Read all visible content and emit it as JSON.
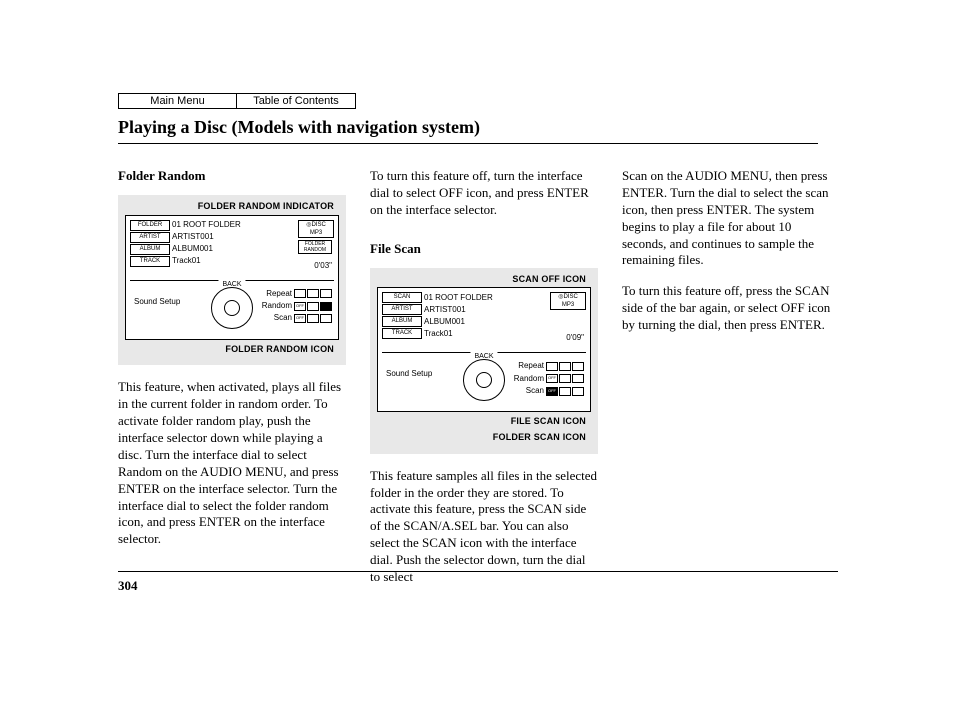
{
  "nav": {
    "main_menu": "Main Menu",
    "toc": "Table of Contents"
  },
  "title": "Playing a Disc (Models with navigation system)",
  "page_number": "304",
  "col1": {
    "heading": "Folder Random",
    "illus": {
      "callout_top": "FOLDER RANDOM INDICATOR",
      "callout_bot": "FOLDER RANDOM ICON",
      "folder_label": "FOLDER",
      "folder_value": "01 ROOT FOLDER",
      "artist_label": "ARTIST",
      "artist_value": "ARTIST001",
      "album_label": "ALBUM",
      "album_value": "ALBUM001",
      "track_label": "TRACK",
      "track_value": "Track01",
      "disc_line1": "◎DISC",
      "disc_line2": "MP3",
      "rnd_line1": "FOLDER",
      "rnd_line2": "RANDOM",
      "time": "0'03\"",
      "back": "BACK",
      "sound_setup": "Sound Setup",
      "repeat": "Repeat",
      "random": "Random",
      "scan": "Scan",
      "mi_off": "OFF"
    },
    "para": "This feature, when activated, plays all files in the current folder in random order. To activate folder random play, push the interface selector down while playing a disc. Turn the interface dial to select Random on the AUDIO MENU, and press ENTER on the interface selector. Turn the interface dial to select the folder random icon, and press ENTER on the interface selector."
  },
  "col2": {
    "para_top": "To turn this feature off, turn the interface dial to select OFF icon, and press ENTER on the interface selector.",
    "heading": "File Scan",
    "illus": {
      "callout_top": "SCAN OFF ICON",
      "callout_bot1": "FILE SCAN ICON",
      "callout_bot2": "FOLDER SCAN ICON",
      "folder_label": "SCAN",
      "folder_value": "01 ROOT FOLDER",
      "artist_label": "ARTIST",
      "artist_value": "ARTIST001",
      "album_label": "ALBUM",
      "album_value": "ALBUM001",
      "track_label": "TRACK",
      "track_value": "Track01",
      "disc_line1": "◎DISC",
      "disc_line2": "MP3",
      "time": "0'09\"",
      "back": "BACK",
      "sound_setup": "Sound Setup",
      "repeat": "Repeat",
      "random": "Random",
      "scan": "Scan",
      "mi_off": "OFF"
    },
    "para_bot": "This feature samples all files in the selected folder in the order they are stored. To activate this feature, press the SCAN side of the SCAN/A.SEL bar. You can also select the SCAN icon with the interface dial. Push the selector down, turn the dial to select"
  },
  "col3": {
    "para1": "Scan on the AUDIO MENU, then press ENTER. Turn the dial to select the scan icon, then press ENTER. The system begins to play a file for about 10 seconds, and continues to sample the remaining files.",
    "para2": "To turn this feature off, press the SCAN side of the bar again, or select OFF icon by turning the dial, then press ENTER."
  }
}
